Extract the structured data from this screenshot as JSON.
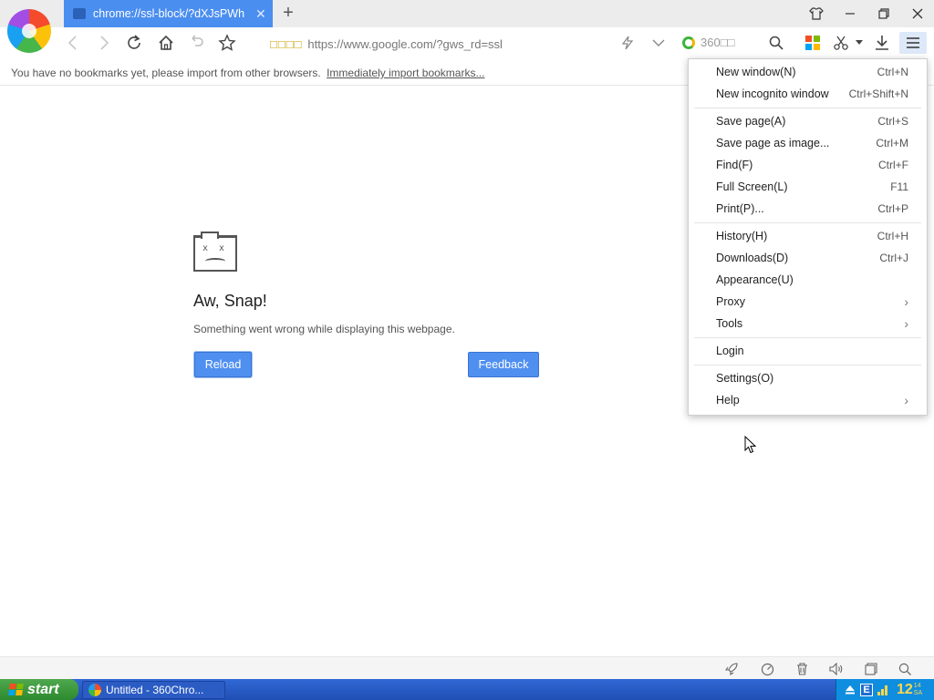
{
  "tab": {
    "title": "chrome://ssl-block/?dXJsPWh",
    "close": "✕"
  },
  "new_tab": "+",
  "toolbar": {
    "secure_glyphs": "□□□□",
    "url": "https://www.google.com/?gws_rd=ssl",
    "ext_label": "360□□"
  },
  "bookmark_notice": {
    "text": "You have no bookmarks yet, please import from other browsers.",
    "link": "Immediately import bookmarks..."
  },
  "error_page": {
    "title": "Aw, Snap!",
    "message": "Something went wrong while displaying this webpage.",
    "reload_label": "Reload",
    "feedback_label": "Feedback"
  },
  "menu": {
    "items": [
      {
        "label": "New window(N)",
        "shortcut": "Ctrl+N"
      },
      {
        "label": "New incognito window",
        "shortcut": "Ctrl+Shift+N"
      },
      {
        "label": "Save page(A)",
        "shortcut": "Ctrl+S"
      },
      {
        "label": "Save page as image...",
        "shortcut": "Ctrl+M"
      },
      {
        "label": "Find(F)",
        "shortcut": "Ctrl+F"
      },
      {
        "label": "Full Screen(L)",
        "shortcut": "F11"
      },
      {
        "label": "Print(P)...",
        "shortcut": "Ctrl+P"
      },
      {
        "label": "History(H)",
        "shortcut": "Ctrl+H"
      },
      {
        "label": "Downloads(D)",
        "shortcut": "Ctrl+J"
      },
      {
        "label": "Appearance(U)",
        "shortcut": ""
      },
      {
        "label": "Proxy",
        "shortcut": ""
      },
      {
        "label": "Tools",
        "shortcut": ""
      },
      {
        "label": "Login",
        "shortcut": ""
      },
      {
        "label": "Settings(O)",
        "shortcut": ""
      },
      {
        "label": "Help",
        "shortcut": ""
      }
    ]
  },
  "taskbar": {
    "start_label": "start",
    "task_label": "Untitled - 360Chro...",
    "tray_e": "E",
    "clock": "12",
    "clock_sub_top": "14",
    "clock_sub_bottom": "SA"
  },
  "colors": {
    "tab_active": "#4a8ef0",
    "button_blue": "#4f8ff0",
    "taskbar": "#245edb",
    "start_green": "#3c9a3c"
  }
}
